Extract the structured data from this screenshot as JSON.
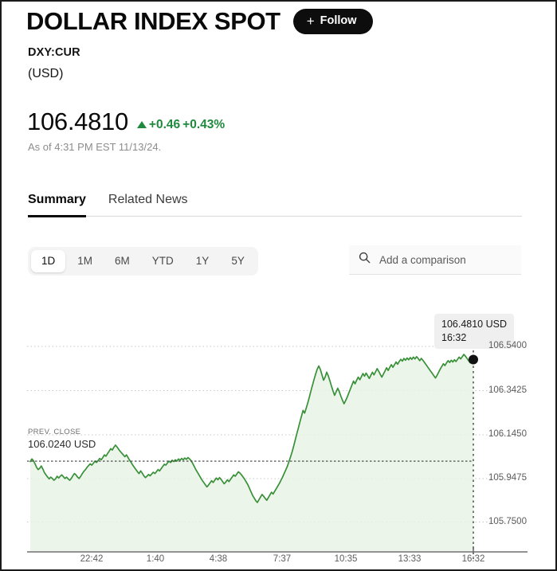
{
  "header": {
    "title": "DOLLAR INDEX SPOT",
    "follow_label": "Follow",
    "follow_plus": "+",
    "ticker": "DXY:CUR",
    "currency": "(USD)"
  },
  "quote": {
    "price": "106.4810",
    "change_abs": "+0.46",
    "change_pct": "+0.43%",
    "direction": "up",
    "as_of": "As of 4:31 PM EST 11/13/24.",
    "positive_color": "#1f8a3d"
  },
  "tabs": [
    {
      "label": "Summary",
      "active": true
    },
    {
      "label": "Related News",
      "active": false
    }
  ],
  "controls": {
    "ranges": [
      {
        "label": "1D",
        "active": true
      },
      {
        "label": "1M",
        "active": false
      },
      {
        "label": "6M",
        "active": false
      },
      {
        "label": "YTD",
        "active": false
      },
      {
        "label": "1Y",
        "active": false
      },
      {
        "label": "5Y",
        "active": false
      }
    ],
    "search": {
      "icon": "search-icon",
      "placeholder": "Add a comparison",
      "value": ""
    }
  },
  "chart": {
    "tooltip_price": "106.4810 USD",
    "tooltip_time": "16:32",
    "prev_close_title": "PREV. CLOSE",
    "prev_close_value": "106.0240 USD",
    "line_color": "#389038",
    "fill_color": "#e9f3e6",
    "marker_color": "#111111"
  },
  "chart_data": {
    "type": "line",
    "title": "DOLLAR INDEX SPOT (DXY:CUR) 1D",
    "xlabel": "",
    "ylabel": "USD",
    "grid": true,
    "legend": "none",
    "ylim": [
      105.75,
      106.54
    ],
    "y_ticks": [
      "106.5400",
      "106.3425",
      "106.1450",
      "105.9475",
      "105.7500"
    ],
    "y_tick_values": [
      106.54,
      106.3425,
      106.145,
      105.9475,
      105.75
    ],
    "x_ticks": [
      "22:42",
      "1:40",
      "4:38",
      "7:37",
      "10:35",
      "13:33",
      "16:32"
    ],
    "prev_close": 106.024,
    "last_value": 106.481,
    "last_time": "16:32",
    "series": [
      {
        "name": "DXY:CUR",
        "color": "#389038",
        "values": [
          106.022,
          106.034,
          106.026,
          106.012,
          105.996,
          105.986,
          105.992,
          106.002,
          105.988,
          105.972,
          105.962,
          105.952,
          105.944,
          105.952,
          105.946,
          105.938,
          105.944,
          105.956,
          105.948,
          105.956,
          105.962,
          105.954,
          105.946,
          105.952,
          105.944,
          105.938,
          105.946,
          105.958,
          105.968,
          105.962,
          105.952,
          105.946,
          105.956,
          105.968,
          105.978,
          105.986,
          105.996,
          106.004,
          106.012,
          106.006,
          106.014,
          106.024,
          106.018,
          106.026,
          106.036,
          106.03,
          106.04,
          106.052,
          106.046,
          106.058,
          106.068,
          106.08,
          106.074,
          106.086,
          106.096,
          106.088,
          106.078,
          106.068,
          106.06,
          106.052,
          106.044,
          106.052,
          106.04,
          106.028,
          106.018,
          106.006,
          105.996,
          105.986,
          105.976,
          105.968,
          105.98,
          105.97,
          105.958,
          105.95,
          105.956,
          105.964,
          105.958,
          105.966,
          105.974,
          105.968,
          105.976,
          105.986,
          105.98,
          105.99,
          106.0,
          106.01,
          106.006,
          106.016,
          106.024,
          106.018,
          106.028,
          106.022,
          106.03,
          106.024,
          106.034,
          106.028,
          106.036,
          106.03,
          106.038,
          106.032,
          106.04,
          106.034,
          106.026,
          106.014,
          106.0,
          105.986,
          105.974,
          105.962,
          105.95,
          105.938,
          105.928,
          105.918,
          105.908,
          105.916,
          105.926,
          105.936,
          105.928,
          105.938,
          105.948,
          105.94,
          105.95,
          105.942,
          105.932,
          105.922,
          105.93,
          105.94,
          105.932,
          105.942,
          105.952,
          105.962,
          105.956,
          105.966,
          105.976,
          105.97,
          105.962,
          105.952,
          105.942,
          105.93,
          105.918,
          105.902,
          105.886,
          105.87,
          105.858,
          105.846,
          105.838,
          105.85,
          105.862,
          105.874,
          105.866,
          105.856,
          105.848,
          105.86,
          105.872,
          105.884,
          105.876,
          105.888,
          105.9,
          105.912,
          105.924,
          105.938,
          105.952,
          105.968,
          105.984,
          106.0,
          106.02,
          106.042,
          106.064,
          106.09,
          106.118,
          106.146,
          106.172,
          106.2,
          106.226,
          106.252,
          106.24,
          106.262,
          106.286,
          106.312,
          106.34,
          106.366,
          106.392,
          106.416,
          106.438,
          106.452,
          106.436,
          106.412,
          106.388,
          106.402,
          106.424,
          106.408,
          106.386,
          106.362,
          106.34,
          106.32,
          106.336,
          106.352,
          106.336,
          106.316,
          106.298,
          106.282,
          106.296,
          106.312,
          106.33,
          106.348,
          106.366,
          106.384,
          106.372,
          106.388,
          106.402,
          106.39,
          106.404,
          106.418,
          106.406,
          106.42,
          106.408,
          106.396,
          106.41,
          106.424,
          106.412,
          106.426,
          106.44,
          106.428,
          106.414,
          106.402,
          106.416,
          106.43,
          106.444,
          106.432,
          106.446,
          106.458,
          106.446,
          106.458,
          106.47,
          106.46,
          106.472,
          106.482,
          106.474,
          106.486,
          106.478,
          106.488,
          106.48,
          106.49,
          106.482,
          106.492,
          106.484,
          106.494,
          106.486,
          106.476,
          106.486,
          106.478,
          106.468,
          106.458,
          106.448,
          106.438,
          106.428,
          106.418,
          106.408,
          106.398,
          106.41,
          106.424,
          106.438,
          106.45,
          106.462,
          106.454,
          106.466,
          106.476,
          106.468,
          106.478,
          106.47,
          106.48,
          106.472,
          106.482,
          106.492,
          106.484,
          106.494,
          106.504,
          106.496,
          106.486,
          106.476,
          106.466,
          106.472,
          106.481
        ]
      }
    ]
  }
}
